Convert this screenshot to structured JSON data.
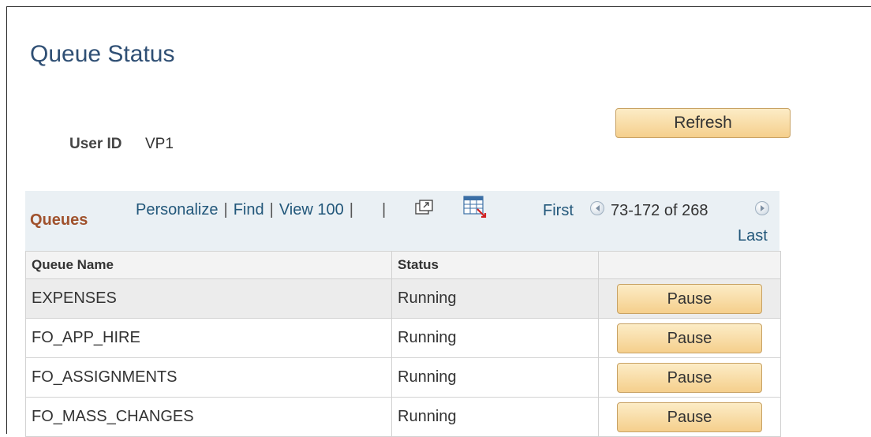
{
  "page": {
    "title": "Queue Status"
  },
  "toolbar": {
    "refresh_label": "Refresh"
  },
  "user": {
    "label": "User ID",
    "value": "VP1"
  },
  "grid": {
    "title": "Queues",
    "personalize": "Personalize",
    "find": "Find",
    "view_all": "View 100",
    "separator": "|",
    "first": "First",
    "range": "73-172 of 268",
    "last": "Last"
  },
  "table": {
    "columns": [
      "Queue Name",
      "Status",
      ""
    ],
    "rows": [
      {
        "name": "EXPENSES",
        "status": "Running",
        "action": "Pause"
      },
      {
        "name": "FO_APP_HIRE",
        "status": "Running",
        "action": "Pause"
      },
      {
        "name": "FO_ASSIGNMENTS",
        "status": "Running",
        "action": "Pause"
      },
      {
        "name": "FO_MASS_CHANGES",
        "status": "Running",
        "action": "Pause"
      }
    ]
  },
  "icons": {
    "zoom": "new-window-icon",
    "download": "download-to-excel-icon",
    "prev": "previous-icon",
    "next": "next-icon"
  },
  "colors": {
    "title": "#2f4f74",
    "grid_title": "#a0522d",
    "link": "#22577a",
    "button_top": "#fcecc6",
    "button_bottom": "#f5cf8c",
    "grid_header_bg": "#eaf0f4"
  }
}
